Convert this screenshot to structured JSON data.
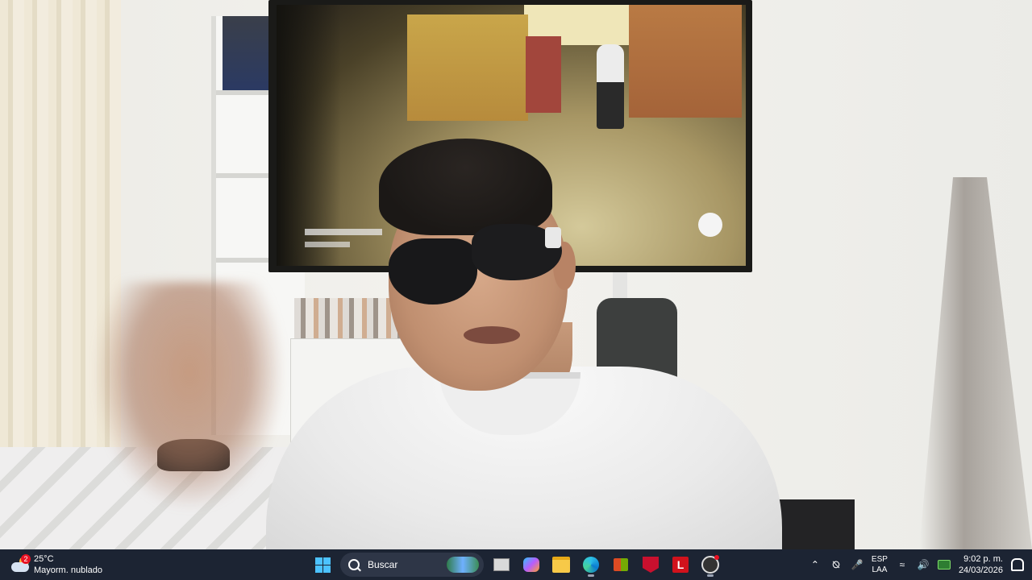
{
  "taskbar": {
    "weather": {
      "temperature": "25°C",
      "condition": "Mayorm. nublado",
      "badge": "2",
      "icon": "partly-cloudy-icon"
    },
    "search": {
      "label": "Buscar"
    },
    "pinned_apps": [
      {
        "name": "start",
        "icon": "windows-logo-icon"
      },
      {
        "name": "task-view",
        "icon": "task-view-icon"
      },
      {
        "name": "copilot",
        "icon": "copilot-icon"
      },
      {
        "name": "file-explorer",
        "icon": "folder-icon"
      },
      {
        "name": "edge",
        "icon": "edge-browser-icon"
      },
      {
        "name": "microsoft-store",
        "icon": "store-icon"
      },
      {
        "name": "mcafee",
        "icon": "mcafee-shield-icon"
      },
      {
        "name": "app-l",
        "icon": "red-l-icon",
        "label": "L"
      },
      {
        "name": "obs",
        "icon": "obs-icon"
      }
    ],
    "tray": {
      "language_top": "ESP",
      "language_bottom": "LAA",
      "time": "9:02 p. m.",
      "date": "24/03/2026"
    },
    "colors": {
      "background": "#1c2433",
      "accent": "#4cc2ff"
    }
  },
  "camera": {
    "description_icon": "webcam-feed"
  }
}
